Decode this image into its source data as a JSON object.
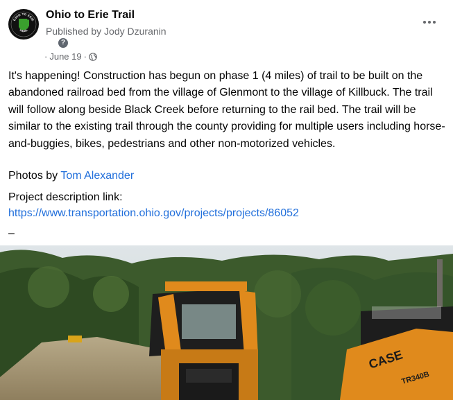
{
  "header": {
    "page_name": "Ohio to Erie Trail",
    "published_by": "Published by Jody Dzuranin",
    "help_glyph": "?",
    "date": "June 19",
    "separator": "·",
    "audience_icon": "globe-icon"
  },
  "avatar": {
    "logo_text_top": "OHIO TO ERIE",
    "logo_text_bottom": "TRAIL"
  },
  "post": {
    "paragraph": "It's happening!  Construction has begun on phase 1 (4 miles) of trail to be built on the abandoned railroad bed from the village of Glenmont to the village of Killbuck. The trail will follow along beside Black Creek before returning to the rail bed. The trail will be similar to the existing trail through the county providing for multiple users including horse-and-buggies, bikes, pedestrians and other non-motorized vehicles.",
    "photos_by_label": "Photos by ",
    "photographer": "Tom Alexander",
    "link_label": "Project description link:",
    "link_url": "https://www.transportation.ohio.gov/projects/projects/86052",
    "trailing_dash": "–"
  },
  "photo": {
    "machine_brand": "CASE",
    "machine_model": "TR340B"
  },
  "colors": {
    "accent_link": "#216fdb",
    "secondary_text": "#65676b",
    "machine_orange": "#e08a1c"
  }
}
